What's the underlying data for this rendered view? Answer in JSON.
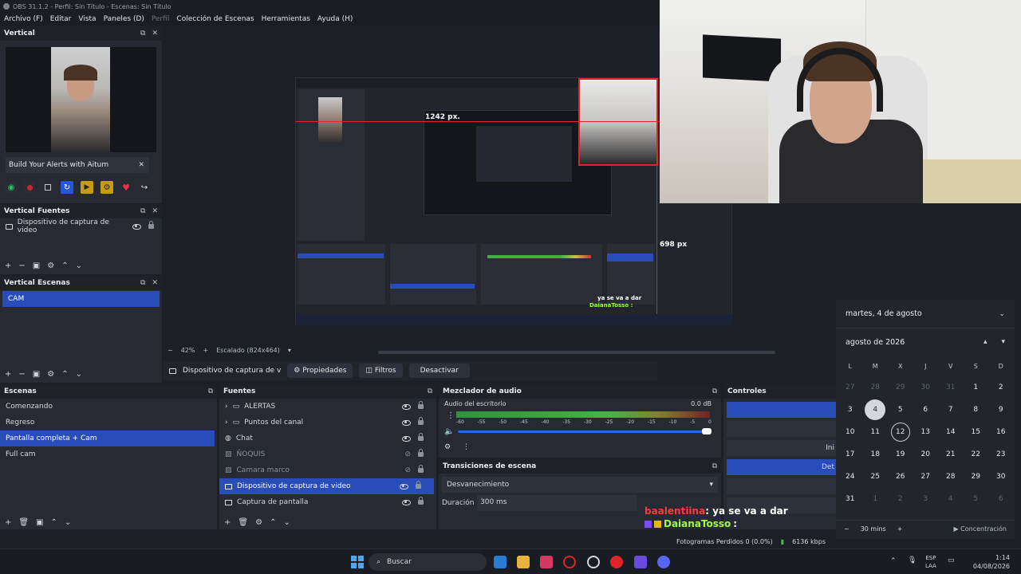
{
  "window": {
    "title": "OBS 31.1.2 - Perfil: Sin Título - Escenas: Sin Título"
  },
  "menu": [
    "Archivo (F)",
    "Editar",
    "Vista",
    "Paneles (D)",
    "Perfil",
    "Colección de Escenas",
    "Herramientas",
    "Ayuda (H)"
  ],
  "vertical": {
    "title": "Vertical",
    "alert_banner": "Build Your Alerts with Aitum",
    "close": "✕"
  },
  "vertical_sources": {
    "title": "Vertical Fuentes",
    "items": [
      "Dispositivo de captura de video"
    ]
  },
  "vertical_scenes": {
    "title": "Vertical Escenas",
    "items": [
      "CAM"
    ]
  },
  "preview": {
    "zoom": "42%",
    "scaling": "Escalado (824x464)",
    "inner_px_label": "1242 px.",
    "inner_px_label2": "698 px",
    "inner_chat_1": "ya se va a dar",
    "inner_chat_2": "DaianaTosso :"
  },
  "source_toolbar": {
    "source_name": "Dispositivo de captura de v",
    "properties": "Propiedades",
    "filters": "Filtros",
    "deactivate": "Desactivar"
  },
  "scenes": {
    "title": "Escenas",
    "items": [
      "Comenzando",
      "Regreso",
      "Pantalla completa + Cam",
      "Full cam"
    ],
    "selected_index": 2
  },
  "sources": {
    "title": "Fuentes",
    "items": [
      {
        "label": "ALERTAS",
        "kind": "folder"
      },
      {
        "label": "Puntos del  canal",
        "kind": "folder"
      },
      {
        "label": "Chat",
        "kind": "browser"
      },
      {
        "label": "ÑOQUIS",
        "kind": "image"
      },
      {
        "label": "Camara marco",
        "kind": "image"
      },
      {
        "label": "Dispositivo de captura de video",
        "kind": "camera"
      },
      {
        "label": "Captura de pantalla",
        "kind": "monitor"
      }
    ]
  },
  "mixer": {
    "title": "Mezclador de audio",
    "channel": "Audio del escritorio",
    "level": "0.0 dB",
    "scale": [
      "-60",
      "-55",
      "-50",
      "-45",
      "-40",
      "-35",
      "-30",
      "-25",
      "-20",
      "-15",
      "-10",
      "-5",
      "0"
    ]
  },
  "transitions": {
    "title": "Transiciones de escena",
    "selected": "Desvanecimiento",
    "duration_label": "Duración",
    "duration_value": "300 ms"
  },
  "controls": {
    "title": "Controles",
    "partial_1": "Ini",
    "partial_2": "Det"
  },
  "status": {
    "dropped": "Fotogramas Perdidos 0 (0.0%)",
    "bitrate": "6136 kbps"
  },
  "overlay_chat": [
    {
      "user": "baalentiina",
      "msg": ": ya se va a dar",
      "color": "#ff3b3b"
    },
    {
      "user": "DaianaTosso",
      "msg": ":",
      "color": "#9bff3b"
    }
  ],
  "calendar": {
    "header_date": "martes, 4 de agosto",
    "month": "agosto de 2026",
    "weekdays": [
      "L",
      "M",
      "X",
      "J",
      "V",
      "S",
      "D"
    ],
    "weeks": [
      [
        "27",
        "28",
        "29",
        "30",
        "31",
        "1",
        "2"
      ],
      [
        "3",
        "4",
        "5",
        "6",
        "7",
        "8",
        "9"
      ],
      [
        "10",
        "11",
        "12",
        "13",
        "14",
        "15",
        "16"
      ],
      [
        "17",
        "18",
        "19",
        "20",
        "21",
        "22",
        "23"
      ],
      [
        "24",
        "25",
        "26",
        "27",
        "28",
        "29",
        "30"
      ],
      [
        "31",
        "1",
        "2",
        "3",
        "4",
        "5",
        "6"
      ]
    ],
    "focus_duration": "30 mins",
    "focus_button": "Concentración"
  },
  "taskbar": {
    "search": "Buscar",
    "lang_1": "ESP",
    "lang_2": "LAA",
    "time": "1:14",
    "date": "04/08/2026"
  },
  "colors": {
    "accent": "#284cb8",
    "panel": "#272a33",
    "background": "#1d1f26"
  }
}
